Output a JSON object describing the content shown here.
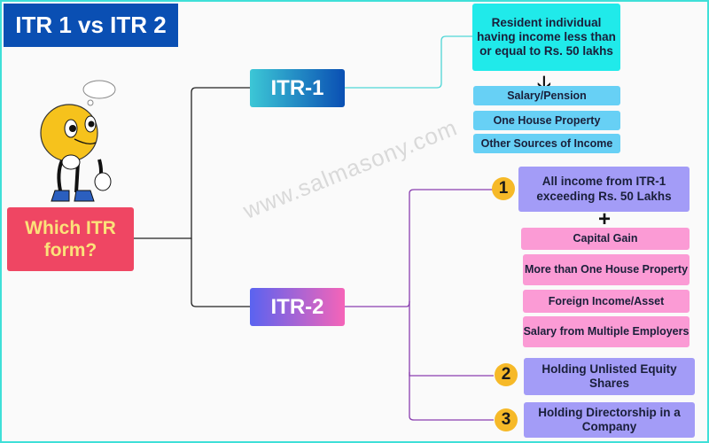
{
  "title": "ITR 1 vs ITR 2",
  "watermark": "www.salmasony.com",
  "root": {
    "label": "Which ITR form?",
    "mascot_icon": "thinking-emoji-mascot"
  },
  "itr1": {
    "label": "ITR-1",
    "eligibility": "Resident individual having income less than or equal to Rs. 50 lakhs",
    "arrow_icon": "arrow-down",
    "items": [
      "Salary/Pension",
      "One House Property",
      "Other Sources of Income"
    ]
  },
  "itr2": {
    "label": "ITR-2",
    "conditions": [
      {
        "number": "1",
        "text": "All income from ITR-1 exceeding Rs. 50 Lakhs"
      },
      {
        "number": "2",
        "text": "Holding Unlisted Equity Shares"
      },
      {
        "number": "3",
        "text": "Holding Directorship in a Company"
      }
    ],
    "plus_icon": "plus",
    "additional_items": [
      "Capital Gain",
      "More than One House Property",
      "Foreign Income/Asset",
      "Salary from Multiple Employers"
    ]
  },
  "colors": {
    "title_bg": "#0a4fb3",
    "root_bg": "#ef4663",
    "itr1_box": "#20eaea",
    "itr1_items": "#67d0f5",
    "itr2_conditions": "#a39cf7",
    "itr2_items": "#fb9bd5",
    "badge": "#f6b928"
  }
}
